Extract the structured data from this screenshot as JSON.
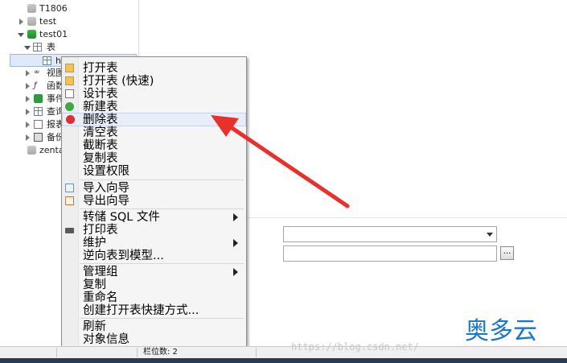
{
  "tree": {
    "items": [
      {
        "label": "T1806",
        "icon": "database-icon"
      },
      {
        "label": "test",
        "icon": "database-icon"
      },
      {
        "label": "test01",
        "icon": "database-icon"
      },
      {
        "label": "表",
        "icon": "tables-folder-icon"
      },
      {
        "label": "h",
        "icon": "table-icon"
      },
      {
        "label": "视图",
        "icon": "views-icon"
      },
      {
        "label": "函数",
        "icon": "functions-icon"
      },
      {
        "label": "事件",
        "icon": "events-icon"
      },
      {
        "label": "查询",
        "icon": "queries-icon"
      },
      {
        "label": "报表",
        "icon": "reports-icon"
      },
      {
        "label": "备份",
        "icon": "backups-icon"
      },
      {
        "label": "zenta",
        "icon": "database-icon"
      }
    ]
  },
  "context_menu": {
    "items": [
      {
        "label": "打开表",
        "icon": "open-table-icon"
      },
      {
        "label": "打开表 (快速)",
        "icon": "open-table-fast-icon"
      },
      {
        "label": "设计表",
        "icon": "design-table-icon"
      },
      {
        "label": "新建表",
        "icon": "new-table-icon"
      },
      {
        "label": "删除表",
        "icon": "delete-table-icon"
      },
      {
        "label": "清空表"
      },
      {
        "label": "截断表"
      },
      {
        "label": "复制表"
      },
      {
        "label": "设置权限"
      },
      {
        "label": "导入向导",
        "icon": "import-wizard-icon"
      },
      {
        "label": "导出向导",
        "icon": "export-wizard-icon"
      },
      {
        "label": "转储 SQL 文件",
        "submenu": true
      },
      {
        "label": "打印表",
        "icon": "print-icon"
      },
      {
        "label": "维护",
        "submenu": true
      },
      {
        "label": "逆向表到模型..."
      },
      {
        "label": "管理组",
        "submenu": true
      },
      {
        "label": "复制"
      },
      {
        "label": "重命名"
      },
      {
        "label": "创建打开表快捷方式..."
      },
      {
        "label": "刷新"
      },
      {
        "label": "对象信息"
      }
    ],
    "highlighted": "删除表"
  },
  "form": {
    "combo_value": "",
    "field_value": "",
    "browse_label": "..."
  },
  "statusbar": {
    "text": "栏位数: 2"
  },
  "watermark": "https://blog.csdn.net/",
  "brand": "奥多云",
  "colors": {
    "annotation_arrow": "#e5322d",
    "brand": "#1b75d0",
    "menu_highlight": "#e8eef8"
  }
}
